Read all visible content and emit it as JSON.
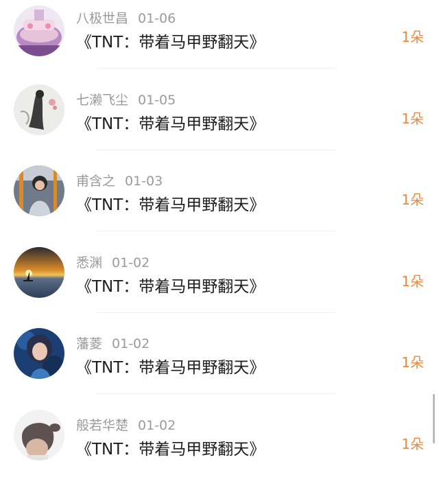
{
  "items": [
    {
      "name": "八极世昌",
      "date": "01-06",
      "title": "《TNT：带着马甲野翻天》",
      "count": "1朵",
      "avatar_icon": "avatar-purple-scene"
    },
    {
      "name": "七濑飞尘",
      "date": "01-05",
      "title": "《TNT：带着马甲野翻天》",
      "count": "1朵",
      "avatar_icon": "avatar-ink-painting"
    },
    {
      "name": "甫含之",
      "date": "01-03",
      "title": "《TNT：带着马甲野翻天》",
      "count": "1朵",
      "avatar_icon": "avatar-person-bus"
    },
    {
      "name": "悉渊",
      "date": "01-02",
      "title": "《TNT：带着马甲野翻天》",
      "count": "1朵",
      "avatar_icon": "avatar-sunset-boat"
    },
    {
      "name": "藩菱",
      "date": "01-02",
      "title": "《TNT：带着马甲野翻天》",
      "count": "1朵",
      "avatar_icon": "avatar-blue-character"
    },
    {
      "name": "般若华楚",
      "date": "01-02",
      "title": "《TNT：带着马甲野翻天》",
      "count": "1朵",
      "avatar_icon": "avatar-child-ponytail"
    }
  ],
  "colors": {
    "accent": "#ee8a3c",
    "meta_text": "#9a9a9a",
    "title_text": "#1c1c1c",
    "divider": "#f1f1f1",
    "scrollbar": "#b9b9b9"
  }
}
